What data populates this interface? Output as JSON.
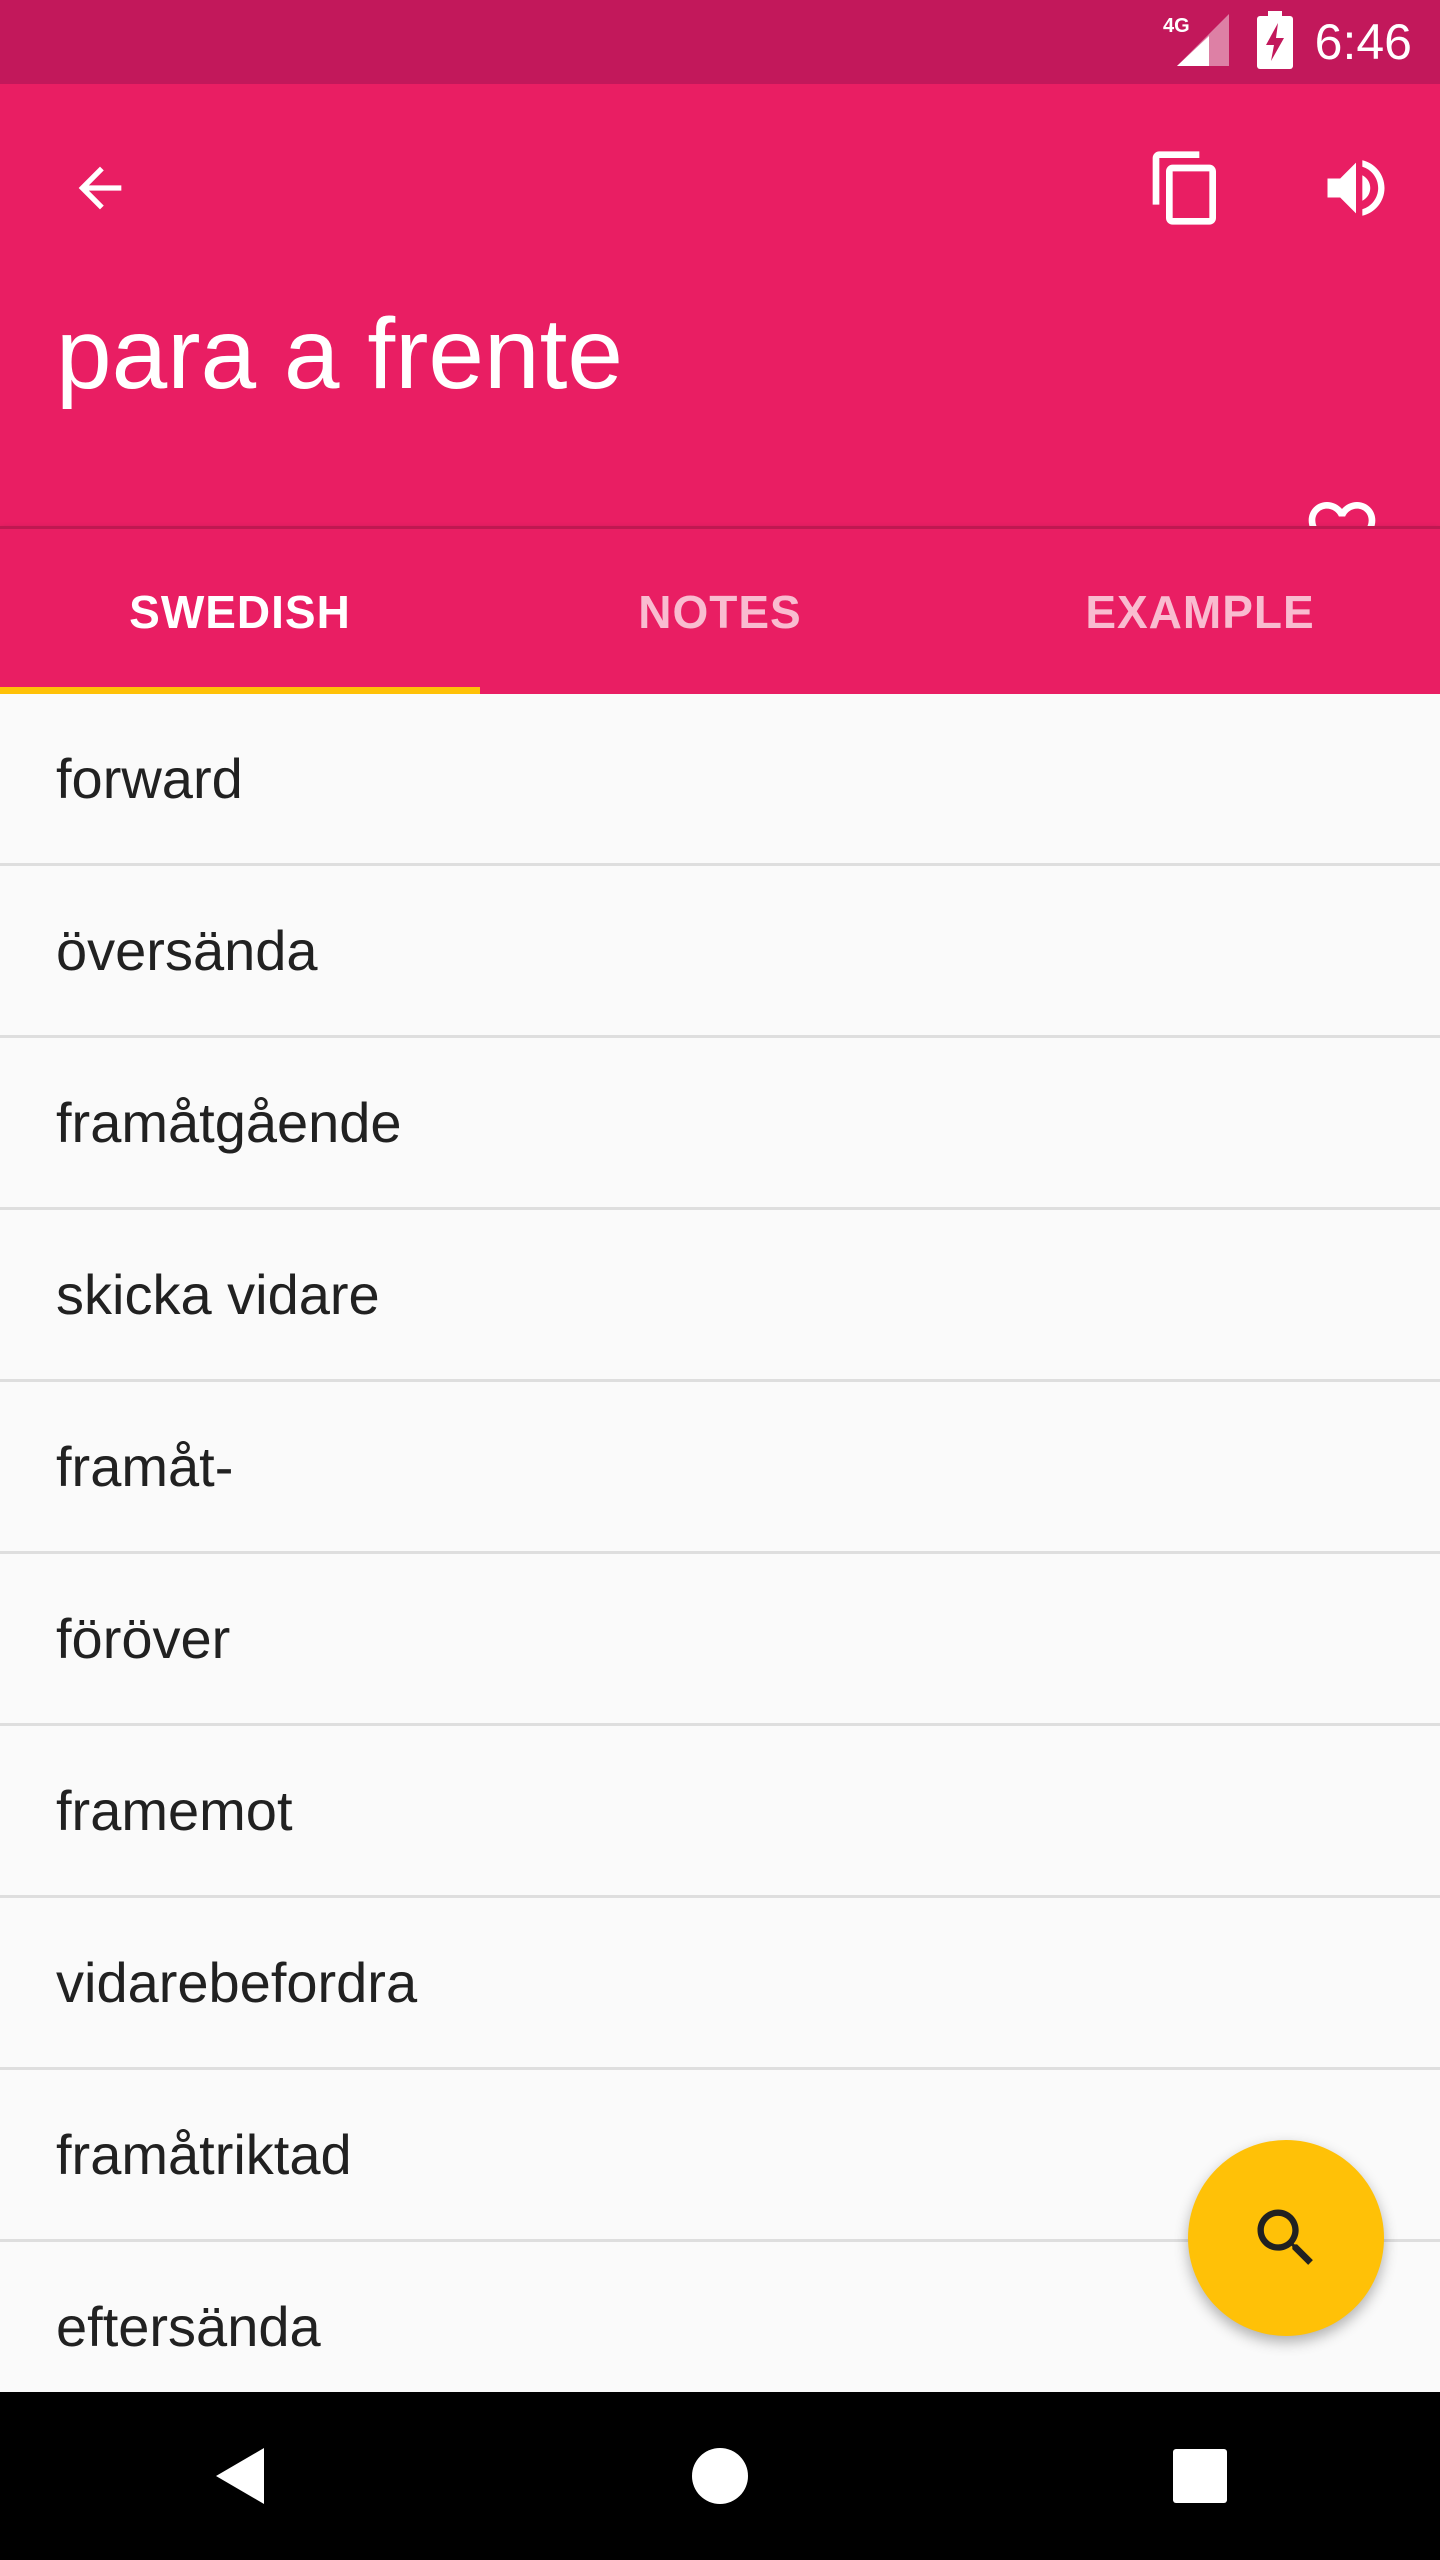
{
  "status_bar": {
    "network": "4G",
    "time": "6:46"
  },
  "app_bar": {
    "title": "para a frente",
    "icons": [
      "arrow-left-icon",
      "copy-icon",
      "volume-icon",
      "heart-outline-icon"
    ]
  },
  "tabs": [
    {
      "label": "SWEDISH",
      "active": true
    },
    {
      "label": "NOTES",
      "active": false
    },
    {
      "label": "EXAMPLE",
      "active": false
    }
  ],
  "translations": [
    "forward",
    "översända",
    "framåtgående",
    "skicka vidare",
    "framåt-",
    "föröver",
    "framemot",
    "vidarebefordra",
    "framåtriktad",
    "eftersända"
  ],
  "fab": {
    "icon": "search-icon"
  },
  "colors": {
    "status_bar": "#c2185b",
    "primary": "#e91e63",
    "accent": "#ffc107",
    "text_primary": "#212121"
  }
}
